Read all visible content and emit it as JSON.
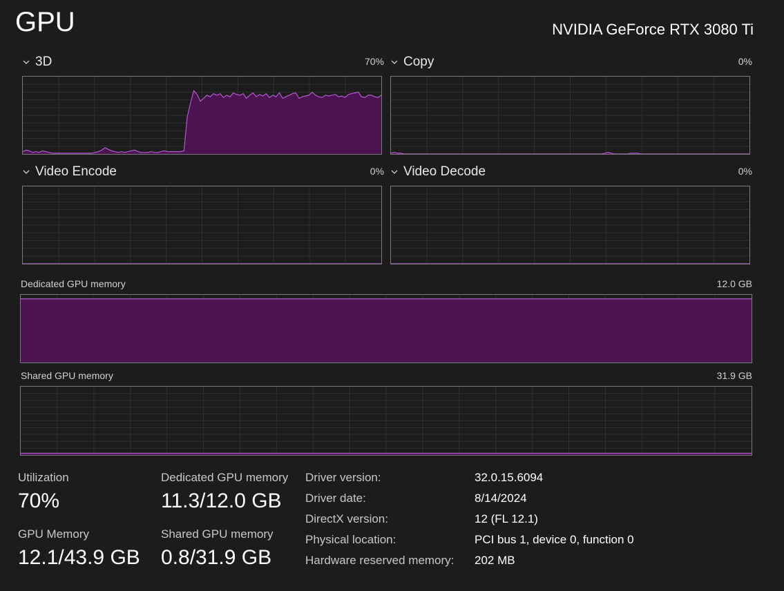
{
  "header": {
    "title": "GPU",
    "gpu_name": "NVIDIA GeForce RTX 3080 Ti"
  },
  "engines": [
    {
      "label": "3D",
      "percent": "70%",
      "history": [
        3,
        5,
        4,
        2,
        3,
        2,
        4,
        3,
        2,
        1,
        1,
        1,
        1,
        1,
        1,
        1,
        1,
        1,
        1,
        1,
        1,
        1,
        2,
        3,
        5,
        8,
        6,
        4,
        3,
        2,
        3,
        2,
        3,
        4,
        5,
        3,
        2,
        2,
        2,
        3,
        2,
        2,
        3,
        4,
        3,
        3,
        3,
        3,
        3,
        4,
        48,
        66,
        82,
        77,
        68,
        72,
        76,
        74,
        78,
        76,
        78,
        73,
        76,
        74,
        79,
        77,
        76,
        78,
        72,
        76,
        79,
        74,
        77,
        75,
        78,
        73,
        76,
        74,
        79,
        72,
        74,
        76,
        78,
        79,
        72,
        74,
        75,
        76,
        80,
        76,
        74,
        73,
        76,
        75,
        76,
        77,
        74,
        75,
        73,
        77,
        78,
        79,
        80,
        74,
        73,
        76,
        76,
        74,
        73,
        76
      ]
    },
    {
      "label": "Copy",
      "percent": "0%",
      "history": [
        1,
        2,
        1,
        1,
        0,
        0,
        0,
        0,
        0,
        0,
        0,
        0,
        0,
        0,
        0,
        0,
        0,
        0,
        0,
        0,
        0,
        0,
        0,
        0,
        0,
        0,
        0,
        0,
        0,
        0,
        0,
        0,
        0,
        0,
        0,
        0,
        0,
        0,
        0,
        0,
        0,
        0,
        0,
        0,
        0,
        0,
        0,
        0,
        0,
        0,
        0,
        0,
        0,
        0,
        0,
        0,
        0,
        0,
        0,
        0,
        0,
        0,
        0,
        0,
        0,
        1,
        2,
        1,
        0,
        0,
        0,
        0,
        0,
        1,
        1,
        1,
        0,
        0,
        0,
        0,
        0,
        0,
        0,
        0,
        0,
        0,
        0,
        0,
        0,
        0,
        0,
        0,
        0,
        0,
        0,
        0,
        0,
        0,
        0,
        0,
        0,
        0,
        0,
        0,
        0,
        0,
        0,
        0,
        0,
        0
      ]
    },
    {
      "label": "Video Encode",
      "percent": "0%",
      "history": [
        0,
        0
      ]
    },
    {
      "label": "Video Decode",
      "percent": "0%",
      "history": [
        0,
        0
      ]
    }
  ],
  "dedicated_memory_graph": {
    "label": "Dedicated GPU memory",
    "max": "12.0 GB",
    "usage_fraction": 0.94
  },
  "shared_memory_graph": {
    "label": "Shared GPU memory",
    "max": "31.9 GB",
    "usage_fraction": 0.025
  },
  "stats": {
    "utilization": {
      "label": "Utilization",
      "value": "70%"
    },
    "dedicated": {
      "label": "Dedicated GPU memory",
      "value": "11.3/12.0 GB"
    },
    "gpu_memory": {
      "label": "GPU Memory",
      "value": "12.1/43.9 GB"
    },
    "shared": {
      "label": "Shared GPU memory",
      "value": "0.8/31.9 GB"
    }
  },
  "info": [
    {
      "label": "Driver version:",
      "value": "32.0.15.6094"
    },
    {
      "label": "Driver date:",
      "value": "8/14/2024"
    },
    {
      "label": "DirectX version:",
      "value": "12 (FL 12.1)"
    },
    {
      "label": "Physical location:",
      "value": "PCI bus 1, device 0, function 0"
    },
    {
      "label": "Hardware reserved memory:",
      "value": "202 MB"
    }
  ],
  "colors": {
    "accent_line": "#b15bd0",
    "accent_fill": "#4b1450",
    "grid": "#2f2f2f",
    "border": "#7a7a7a",
    "background": "#1c1c1c"
  }
}
